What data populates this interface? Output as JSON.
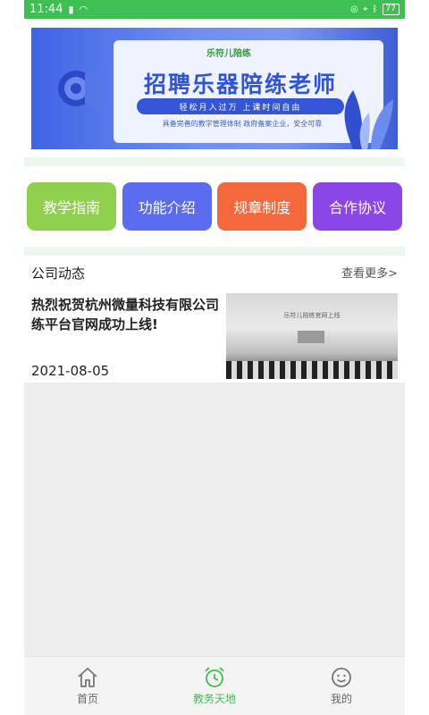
{
  "status_bar": {
    "time": "11:44",
    "battery": "77"
  },
  "banner": {
    "logo_text": "乐符儿陪练",
    "title": "招聘乐器陪练老师",
    "pill_text": "轻松月入过万  上课时间自由",
    "subtitle": "具备完善的教学管理体制  政府备案企业，安全可靠"
  },
  "menu": [
    {
      "label": "教学指南",
      "color": "#8fd14f"
    },
    {
      "label": "功能介绍",
      "color": "#5b6cf0"
    },
    {
      "label": "规章制度",
      "color": "#f4683c"
    },
    {
      "label": "合作协议",
      "color": "#8b46e8"
    }
  ],
  "news": {
    "heading": "公司动态",
    "more": "查看更多>",
    "items": [
      {
        "title": "热烈祝贺杭州微量科技有限公司练平台官网成功上线!",
        "date": "2021-08-05",
        "thumb_text": "乐符儿陪练官网上线"
      }
    ]
  },
  "tabbar": [
    {
      "label": "首页",
      "icon": "home-icon"
    },
    {
      "label": "教务天地",
      "icon": "alarm-clock-icon",
      "active": true
    },
    {
      "label": "我的",
      "icon": "smiley-face-icon"
    }
  ]
}
